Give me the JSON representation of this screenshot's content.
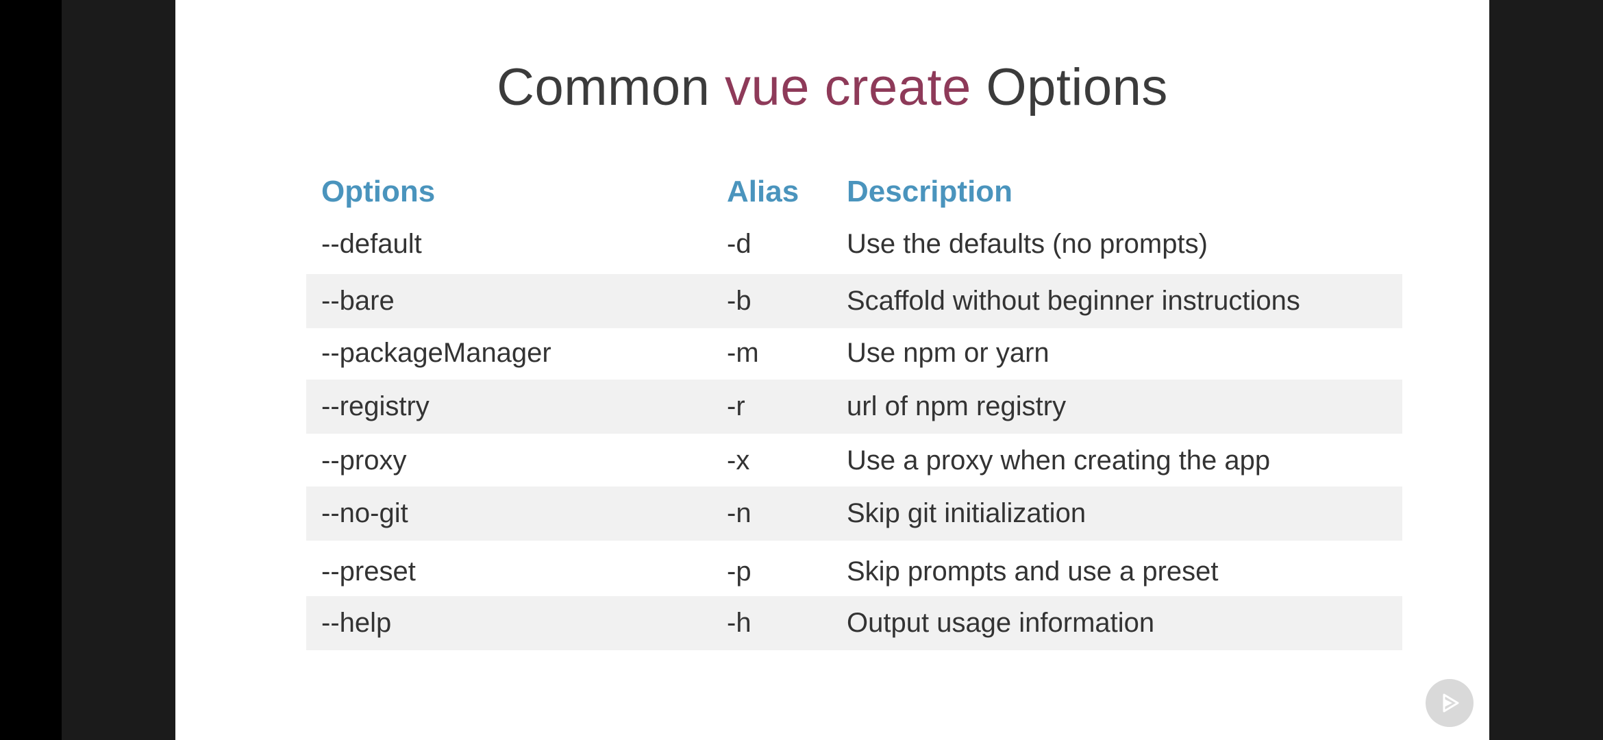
{
  "slide": {
    "title_pre": "Common ",
    "title_accent": "vue create",
    "title_post": " Options",
    "accent_color": "#8e3a59",
    "header_color": "#4a94bd"
  },
  "table": {
    "headers": {
      "option": "Options",
      "alias": "Alias",
      "description": "Description"
    },
    "rows": [
      {
        "option": "--default",
        "alias": "-d",
        "description": "Use the defaults (no prompts)"
      },
      {
        "option": "--bare",
        "alias": "-b",
        "description": "Scaffold without beginner instructions"
      },
      {
        "option": "--packageManager",
        "alias": "-m",
        "description": "Use npm or yarn"
      },
      {
        "option": "--registry",
        "alias": "-r",
        "description": "url of npm registry"
      },
      {
        "option": "--proxy",
        "alias": "-x",
        "description": "Use a proxy when creating the app"
      },
      {
        "option": "--no-git",
        "alias": "-n",
        "description": "Skip git initialization"
      },
      {
        "option": "--preset",
        "alias": "-p",
        "description": "Skip prompts and use a preset"
      },
      {
        "option": "--help",
        "alias": "-h",
        "description": "Output usage information"
      }
    ]
  },
  "controls": {
    "play_icon": "play-icon"
  }
}
